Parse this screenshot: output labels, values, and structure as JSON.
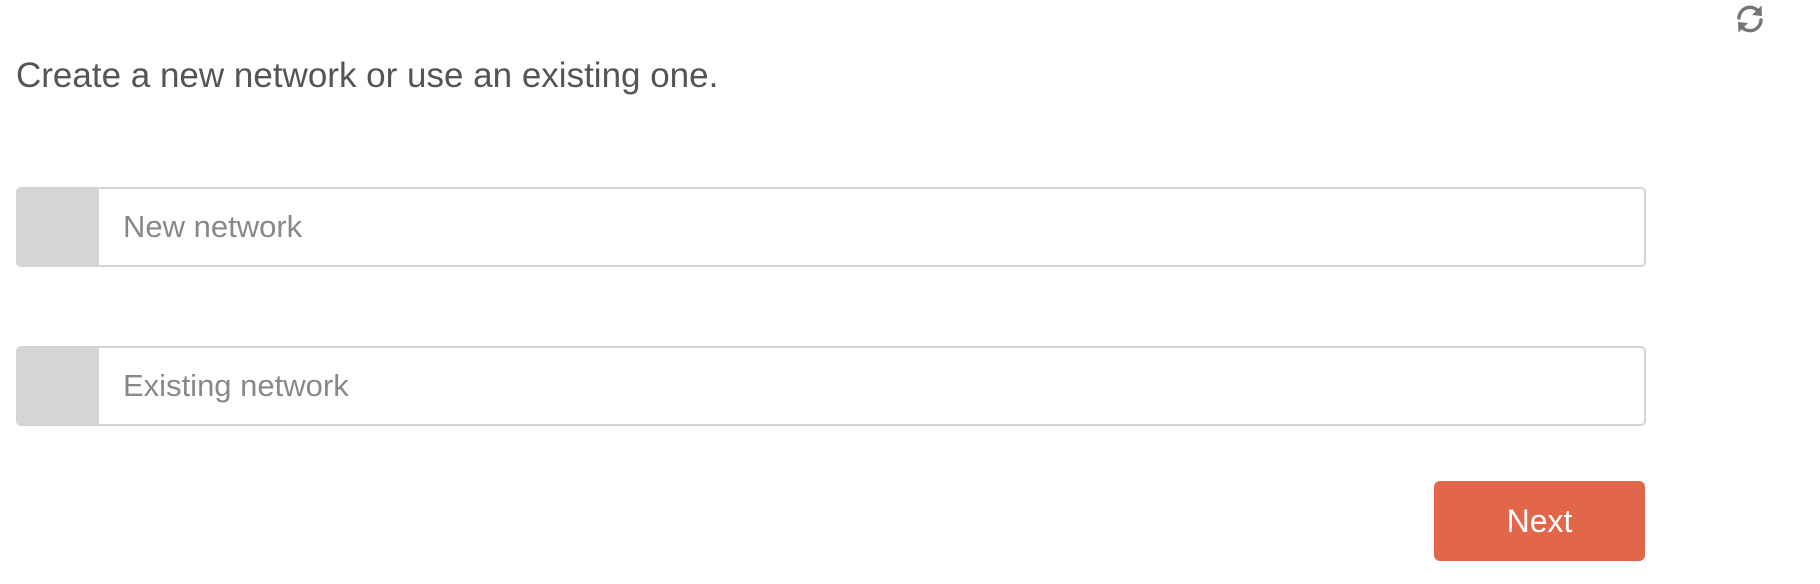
{
  "toolbar": {
    "refresh_icon": "refresh-icon"
  },
  "instruction": "Create a new network or use an existing one.",
  "options": [
    {
      "label": "New network",
      "selected": false
    },
    {
      "label": "Existing network",
      "selected": false
    }
  ],
  "next_button": {
    "label": "Next"
  },
  "colors": {
    "text": "#555555",
    "option_label": "#898989",
    "selector_fill": "#d4d5d7",
    "border": "#d4d4d4",
    "accent": "#e2664a",
    "icon": "#757575"
  }
}
